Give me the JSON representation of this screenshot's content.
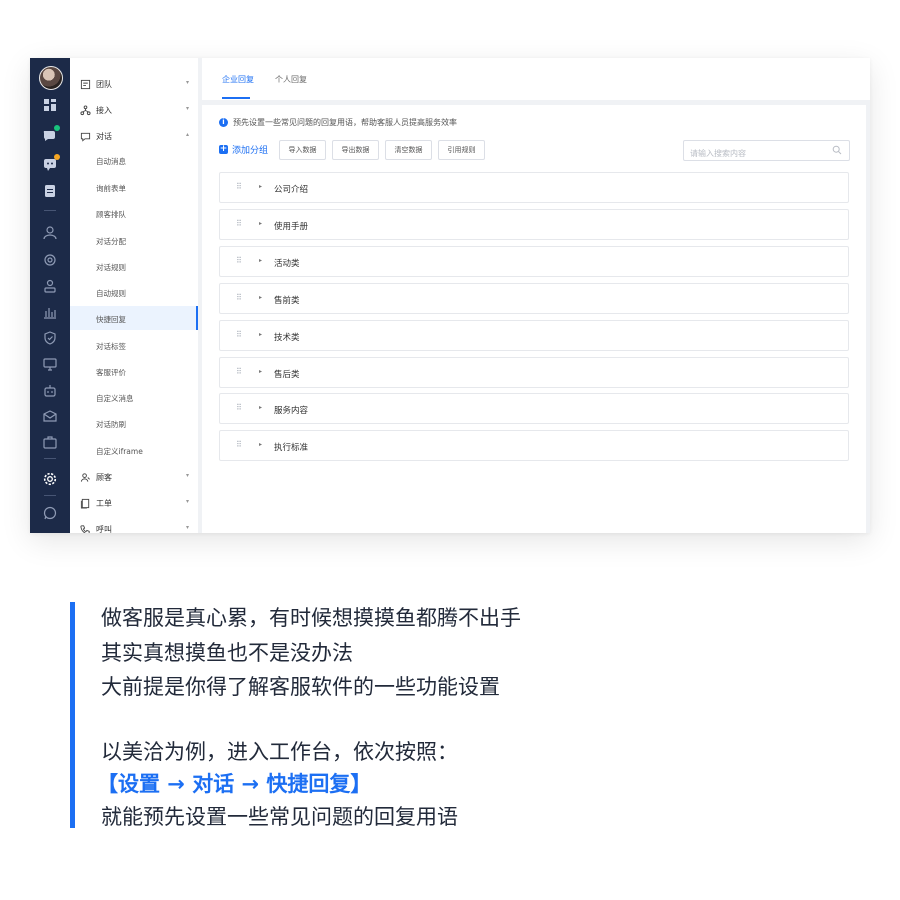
{
  "sidebar_rail": {
    "icons": [
      "avatar",
      "dashboard-icon",
      "chat-bubbles-icon",
      "message-badge-icon",
      "clipboard-icon",
      "user-icon",
      "cloud-icon",
      "contacts-icon",
      "bar-chart-icon",
      "shield-icon",
      "monitor-icon",
      "robot-icon",
      "mail-icon",
      "briefcase-icon",
      "gear-icon",
      "whatsapp-icon"
    ],
    "badge_colors": [
      "#19c37d",
      "#f5a623"
    ]
  },
  "menu": {
    "groups": {
      "team": "团队",
      "access": "接入",
      "dialog": "对话",
      "customer": "顾客",
      "ticket": "工单",
      "call": "呼叫"
    },
    "dialog_items": [
      "自动消息",
      "询前表单",
      "顾客排队",
      "对话分配",
      "对话规则",
      "自动规则",
      "快捷回复",
      "对话标签",
      "客服评价",
      "自定义消息",
      "对话防刷",
      "自定义iframe"
    ],
    "active_item": "快捷回复"
  },
  "tabs": [
    "企业回复",
    "个人回复"
  ],
  "hint": "预先设置一些常见问题的回复用语，帮助客服人员提高服务效率",
  "toolbar": {
    "add_group": "添加分组",
    "buttons": [
      "导入数据",
      "导出数据",
      "清空数据",
      "引用规则"
    ],
    "search_placeholder": "请输入搜索内容"
  },
  "categories": [
    "公司介绍",
    "使用手册",
    "活动类",
    "售前类",
    "技术类",
    "售后类",
    "服务内容",
    "执行标准"
  ],
  "caption": {
    "lines": [
      "做客服是真心累，有时候想摸摸鱼都腾不出手",
      "其实真想摸鱼也不是没办法",
      "大前提是你得了解客服软件的一些功能设置",
      "以美洽为例，进入工作台，依次按照：",
      "【设置 → 对话 → 快捷回复】",
      "就能预先设置一些常见问题的回复用语"
    ]
  },
  "colors": {
    "accent": "#1c6ff3",
    "rail": "#1c2a48"
  }
}
